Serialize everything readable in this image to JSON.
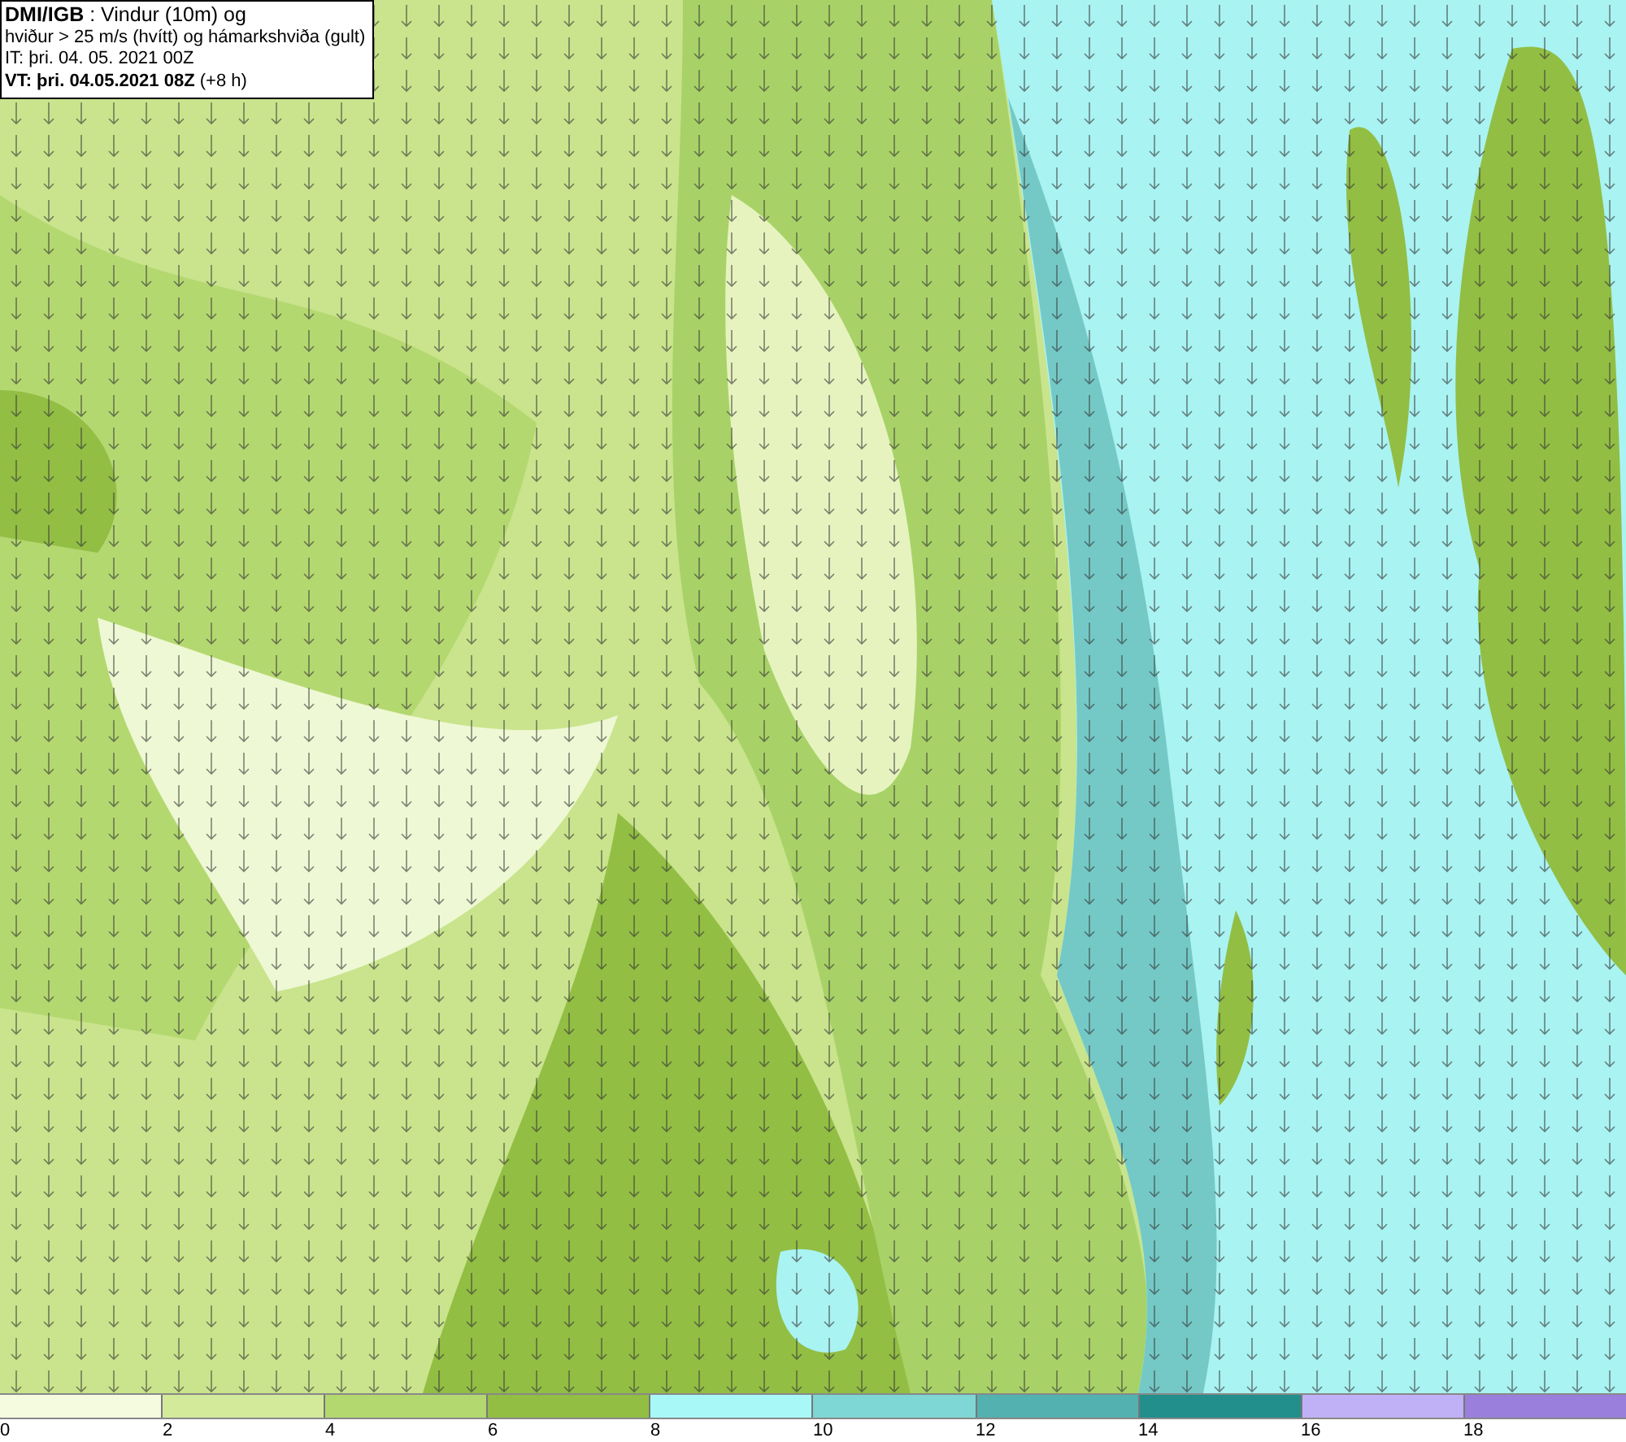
{
  "header": {
    "lines": [
      "**DMI/IGB** : Vindur (10m) og",
      "hviður > 25 m/s (hvítt) og hámarkshviða (gult)",
      "IT: þri. 04. 05. 2021 00Z",
      "**VT: þri. 04.05.2021 08Z** (+8 h)"
    ]
  },
  "legend": {
    "segments": [
      {
        "color": "#f4fbdf",
        "label": "0"
      },
      {
        "color": "#d3ea9b",
        "label": "2"
      },
      {
        "color": "#b4d870",
        "label": "4"
      },
      {
        "color": "#92be44",
        "label": "6"
      },
      {
        "color": "#a9f8f8",
        "label": "8"
      },
      {
        "color": "#7ed7d4",
        "label": "10"
      },
      {
        "color": "#53b1b0",
        "label": "12"
      },
      {
        "color": "#228f8c",
        "label": "14"
      },
      {
        "color": "#c0b1f6",
        "label": "16"
      },
      {
        "color": "#9a80dc",
        "label": "18"
      }
    ]
  }
}
